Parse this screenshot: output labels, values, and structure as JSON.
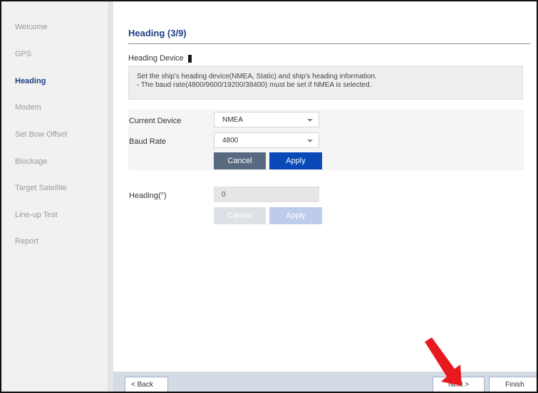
{
  "sidebar": {
    "items": [
      {
        "label": "Welcome",
        "active": false
      },
      {
        "label": "GPS",
        "active": false
      },
      {
        "label": "Heading",
        "active": true
      },
      {
        "label": "Modem",
        "active": false
      },
      {
        "label": "Set Bow Offset",
        "active": false
      },
      {
        "label": "Blockage",
        "active": false
      },
      {
        "label": "Target Satellite",
        "active": false
      },
      {
        "label": "Line-up Test",
        "active": false
      },
      {
        "label": "Report",
        "active": false
      }
    ]
  },
  "main": {
    "title": "Heading (3/9)",
    "section_label": "Heading Device",
    "description": [
      "Set the ship's heading device(NMEA, Static) and ship's heading information.",
      "- The baud rate(4800/9600/19200/38400) must be set if NMEA is selected."
    ],
    "current_device": {
      "label": "Current Device",
      "value": "NMEA"
    },
    "baud_rate": {
      "label": "Baud Rate",
      "value": "4800"
    },
    "device_buttons": {
      "cancel": "Cancel",
      "apply": "Apply"
    },
    "heading": {
      "label": "Heading(°)",
      "value": "0"
    },
    "heading_buttons": {
      "cancel": "Cancel",
      "apply": "Apply"
    }
  },
  "footer": {
    "back": "< Back",
    "next": "Next >",
    "finish": "Finish"
  },
  "colors": {
    "accent": "#1d3f86",
    "apply": "#0a49b8",
    "cancel": "#596a80",
    "pointer": "#e8191e"
  },
  "icons": {
    "pointer": "red-arrow-icon"
  }
}
